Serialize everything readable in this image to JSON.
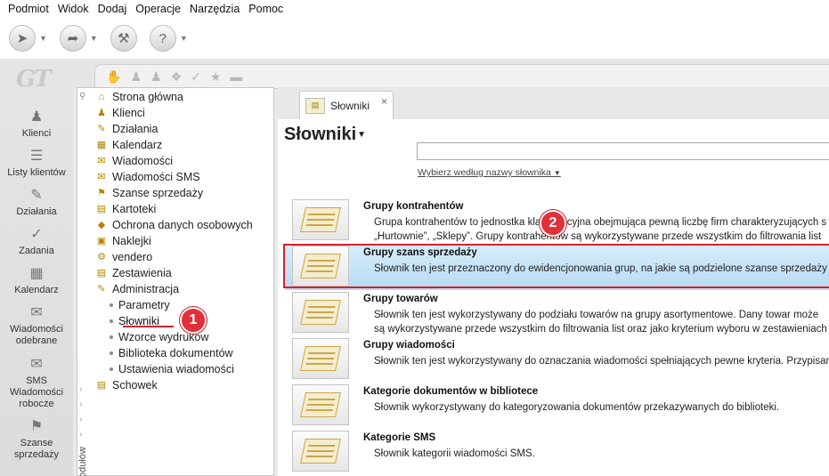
{
  "menubar": [
    "Podmiot",
    "Widok",
    "Dodaj",
    "Operacje",
    "Narzędzia",
    "Pomoc"
  ],
  "toolbar": {
    "buttons": [
      "back-icon",
      "forward-icon",
      "tools-icon",
      "help-icon"
    ]
  },
  "leftnav": {
    "logo": "GT",
    "items": [
      {
        "label": "Klienci",
        "icon": "users-icon"
      },
      {
        "label": "Listy klientów",
        "icon": "list-icon"
      },
      {
        "label": "Działania",
        "icon": "pencil-icon"
      },
      {
        "label": "Zadania",
        "icon": "task-icon"
      },
      {
        "label": "Kalendarz",
        "icon": "calendar-icon"
      },
      {
        "label": "Wiadomości odebrane",
        "icon": "mail-in-icon"
      },
      {
        "label": "SMS Wiadomości robocze",
        "icon": "sms-icon"
      },
      {
        "label": "Szanse sprzedaży",
        "icon": "opportunity-icon"
      }
    ]
  },
  "tree": {
    "items": [
      {
        "label": "Strona główna"
      },
      {
        "label": "Klienci"
      },
      {
        "label": "Działania"
      },
      {
        "label": "Kalendarz"
      },
      {
        "label": "Wiadomości"
      },
      {
        "label": "Wiadomości SMS"
      },
      {
        "label": "Szanse sprzedaży"
      },
      {
        "label": "Kartoteki"
      },
      {
        "label": "Ochrona danych osobowych"
      },
      {
        "label": "Naklejki"
      },
      {
        "label": "vendero"
      },
      {
        "label": "Zestawienia"
      },
      {
        "label": "Administracja"
      }
    ],
    "sub_items": [
      {
        "label": "Parametry"
      },
      {
        "label": "Słowniki"
      },
      {
        "label": "Wzorce wydruków"
      },
      {
        "label": "Biblioteka dokumentów"
      },
      {
        "label": "Ustawienia wiadomości"
      }
    ],
    "last_item": "Schowek",
    "vertical_label": "odułów",
    "badge1": "1"
  },
  "main": {
    "tab_label": "Słowniki",
    "tab_close": "×",
    "page_title": "Słowniki",
    "search_value": "",
    "search_hint": "Wybierz według nazwy słownika",
    "badge2": "2",
    "rows": [
      {
        "title": "Grupy kontrahentów",
        "desc1": "Grupa kontrahentów to jednostka klasyfikacyjna obejmująca pewną liczbę firm charakteryzujących s",
        "desc2": "„Hurtownie”, „Sklepy”. Grupy kontrahentów są wykorzystywane przede wszystkim do filtrowania list"
      },
      {
        "title": "Grupy szans sprzedaży",
        "desc1": "Słownik ten jest przeznaczony do ewidencjonowania grup, na jakie są podzielone szanse sprzedaży",
        "desc2": ""
      },
      {
        "title": "Grupy towarów",
        "desc1": "Słownik ten jest wykorzystywany do podziału towarów na grupy asortymentowe. Dany towar może",
        "desc2": "są wykorzystywane przede wszystkim do filtrowania list oraz jako kryterium wyboru w zestawieniach"
      },
      {
        "title": "Grupy wiadomości",
        "desc1": "Słownik ten jest wykorzystywany do oznaczania wiadomości spełniających pewne kryteria. Przypisan",
        "desc2": ""
      },
      {
        "title": "Kategorie dokumentów w bibliotece",
        "desc1": "Słownik wykorzystywany do kategoryzowania dokumentów przekazywanych do biblioteki.",
        "desc2": ""
      },
      {
        "title": "Kategorie SMS",
        "desc1": "Słownik kategorii wiadomości SMS.",
        "desc2": ""
      }
    ]
  }
}
